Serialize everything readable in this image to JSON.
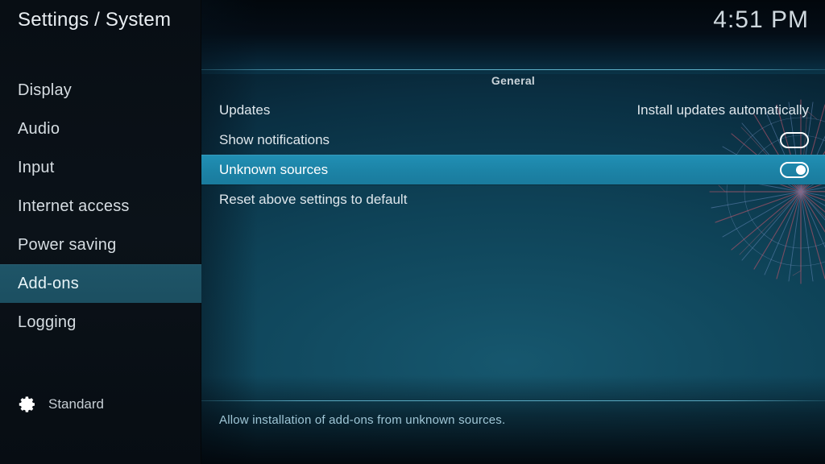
{
  "window": {
    "title": "Settings / System",
    "clock": "4:51 PM"
  },
  "theme": {
    "accent": "#1c83a6",
    "sidebar_selected": "#1e5568",
    "panel_bg": "#0e4257",
    "rule": "#6ec8e2",
    "help_text": "#9fc6d6"
  },
  "sidebar": {
    "items": [
      {
        "label": "Display",
        "selected": false
      },
      {
        "label": "Audio",
        "selected": false
      },
      {
        "label": "Input",
        "selected": false
      },
      {
        "label": "Internet access",
        "selected": false
      },
      {
        "label": "Power saving",
        "selected": false
      },
      {
        "label": "Add-ons",
        "selected": true
      },
      {
        "label": "Logging",
        "selected": false
      }
    ],
    "profile": {
      "icon": "gear-icon",
      "label": "Standard"
    }
  },
  "main": {
    "section_title": "General",
    "rows": [
      {
        "label": "Updates",
        "control": "value",
        "value": "Install updates automatically",
        "selected": false
      },
      {
        "label": "Show notifications",
        "control": "toggle",
        "toggle_state": "off",
        "selected": false
      },
      {
        "label": "Unknown sources",
        "control": "toggle",
        "toggle_state": "on",
        "selected": true
      },
      {
        "label": "Reset above settings to default",
        "control": "none",
        "selected": false
      }
    ],
    "help_text": "Allow installation of add-ons from unknown sources."
  },
  "watermark": {
    "text": ""
  }
}
